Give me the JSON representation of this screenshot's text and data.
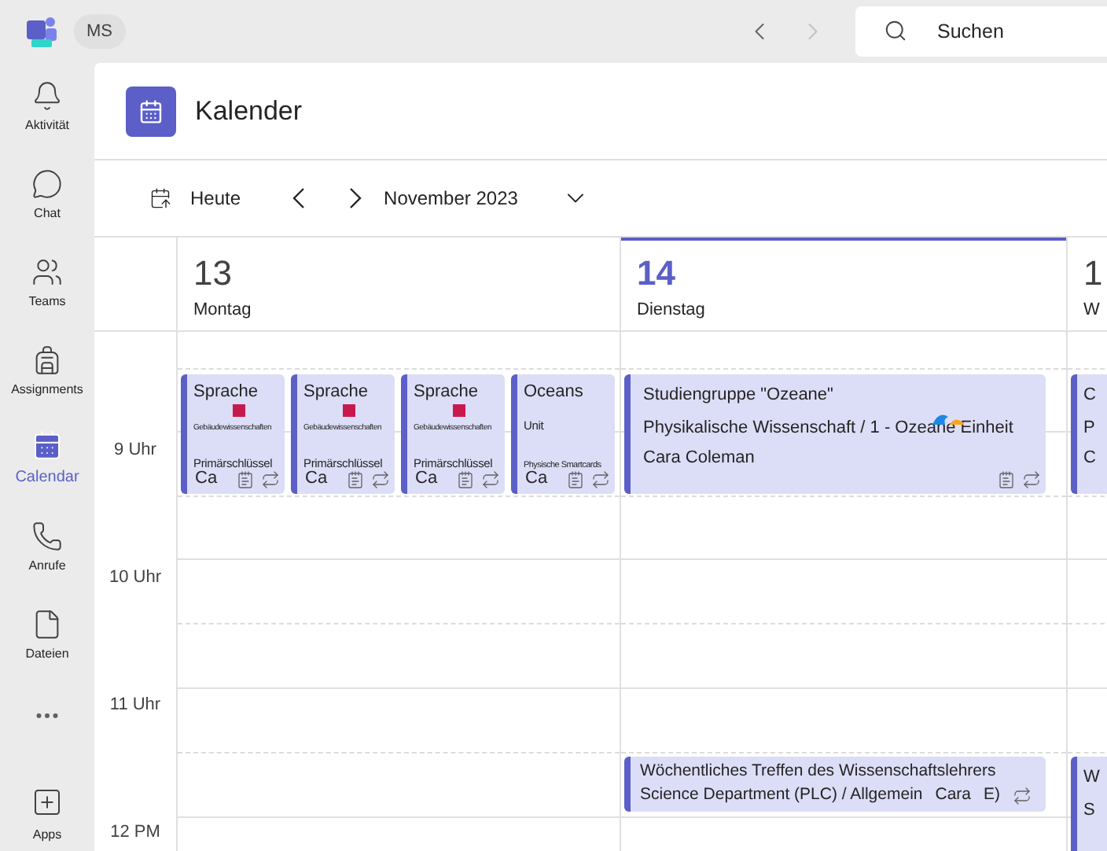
{
  "top_bar": {
    "badge": "MS",
    "search_placeholder": "Suchen"
  },
  "rail": {
    "items": [
      {
        "label": "Aktivität",
        "selected": false
      },
      {
        "label": "Chat",
        "selected": false
      },
      {
        "label": "Teams",
        "selected": false
      },
      {
        "label": "Assignments",
        "selected": false
      },
      {
        "label": "Calendar",
        "selected": true
      },
      {
        "label": "Anrufe",
        "selected": false
      },
      {
        "label": "Dateien",
        "selected": false
      }
    ],
    "apps": "Apps"
  },
  "header": {
    "title": "Kalender"
  },
  "toolbar": {
    "today": "Heute",
    "month": "November 2023"
  },
  "time_labels": [
    "9 Uhr",
    "10 Uhr",
    "11 Uhr",
    "12 PM"
  ],
  "days": [
    {
      "number": "13",
      "weekday": "Montag",
      "selected": false,
      "time_blocks": [
        {
          "events": [
            {
              "kind": "compact",
              "title": "Sprache",
              "lines": [
                {
                  "kind": "tiny",
                  "text": "Gebäudewissenschaften",
                  "square": true
                },
                {
                  "kind": "normal",
                  "text": "Primärschlüssel"
                }
              ],
              "organizer": "Ca",
              "notes": true,
              "recurring": true
            },
            {
              "kind": "compact",
              "title": "Sprache",
              "lines": [
                {
                  "kind": "tiny",
                  "text": "Gebäudewissenschaften",
                  "square": true
                },
                {
                  "kind": "normal",
                  "text": "Primärschlüssel"
                }
              ],
              "organizer": "Ca",
              "notes": true,
              "recurring": true
            },
            {
              "kind": "compact",
              "title": "Sprache",
              "lines": [
                {
                  "kind": "tiny",
                  "text": "Gebäudewissenschaften",
                  "square": true
                },
                {
                  "kind": "normal",
                  "text": "Primärschlüssel"
                }
              ],
              "organizer": "Ca",
              "notes": true,
              "recurring": true
            },
            {
              "kind": "compact",
              "title": "Oceans",
              "lines": [
                {
                  "kind": "normal",
                  "text": "Unit"
                },
                {
                  "kind": "small",
                  "text": "Physische Smartcards"
                }
              ],
              "organizer": "Ca",
              "notes": true,
              "recurring": true
            }
          ]
        }
      ]
    },
    {
      "number": "14",
      "weekday": "Dienstag",
      "selected": true,
      "time_blocks": [
        {
          "events": [
            {
              "kind": "wide",
              "title": "Studiengruppe \"Ozeane\"",
              "lines": [
                {
                  "kind": "normal",
                  "text": "Physikalische Wissenschaft / 1 - Ozeane Einheit",
                  "wave": true
                }
              ],
              "organizer": "Cara Coleman",
              "notes": true,
              "recurring": true
            }
          ]
        },
        {
          "events": [
            {
              "kind": "short",
              "title": "Wöchentliches Treffen des Wissenschaftslehrers",
              "lines": [
                {
                  "kind": "normal",
                  "text": "Science Department (PLC) / Allgemein"
                }
              ],
              "organizer": "Cara",
              "extra": "E)",
              "recurring": true
            }
          ]
        }
      ]
    },
    {
      "number": "1",
      "weekday": "W",
      "selected": false,
      "time_blocks": [
        {
          "events": [
            {
              "kind": "cut",
              "title": "C",
              "lines": [
                {
                  "kind": "normal",
                  "text": "P"
                }
              ],
              "organizer": "C"
            }
          ]
        },
        {
          "events": [
            {
              "kind": "cut",
              "title": "W",
              "lines": [
                {
                  "kind": "normal",
                  "text": "S"
                }
              ]
            }
          ]
        }
      ]
    }
  ]
}
